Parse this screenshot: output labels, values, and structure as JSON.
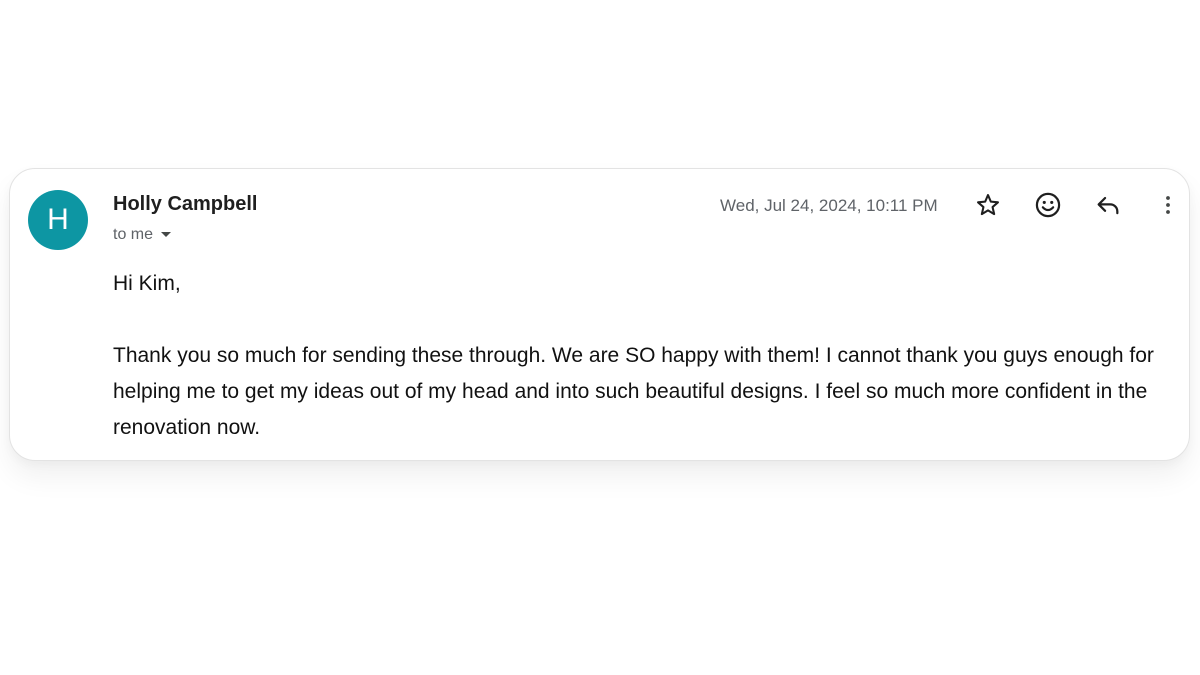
{
  "message": {
    "avatar_letter": "H",
    "avatar_color": "#0d96a3",
    "sender_name": "Holly Campbell",
    "recipient_label": "to me",
    "timestamp": "Wed, Jul 24, 2024, 10:11 PM",
    "actions": {
      "star_icon": "star-outline-icon",
      "emoji_icon": "emoji-reaction-icon",
      "reply_icon": "reply-arrow-icon",
      "more_icon": "more-vertical-icon"
    },
    "body": {
      "greeting": "Hi Kim,",
      "paragraph": "Thank you so much for sending these through. We are SO happy with them! I cannot thank you guys enough for helping me to get my ideas out of my head and into such beautiful designs. I feel so much more confident in the renovation now."
    }
  }
}
